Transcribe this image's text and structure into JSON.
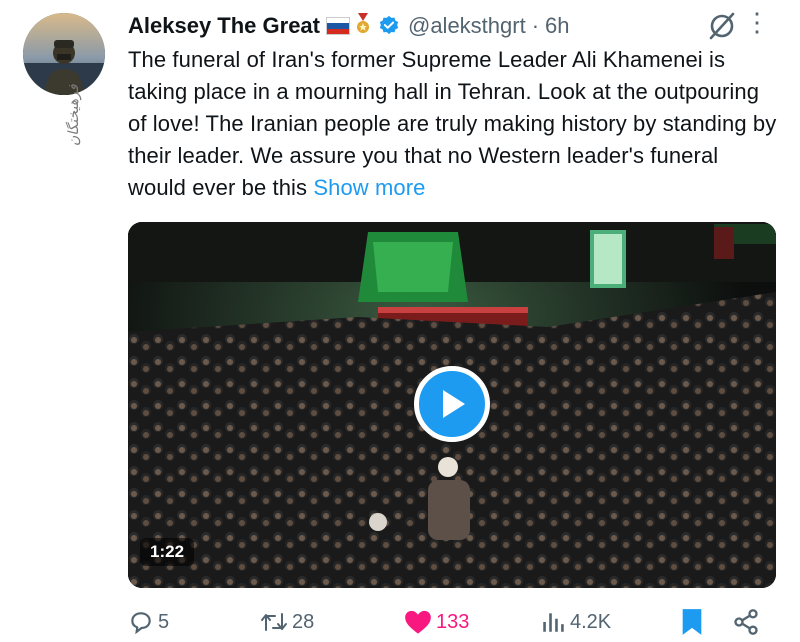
{
  "account": {
    "name": "Aleksey The Great",
    "handle": "@aleksthgrt",
    "time": "6h",
    "flag_icon": "russia-flag-icon",
    "medal_icon": "medal-icon",
    "verified_icon": "verified-badge-icon",
    "verified_color": "#1d9bf0"
  },
  "watermark": "فرهیختگان",
  "tweet": {
    "text": "The funeral of Iran's former Supreme Leader Ali Khamenei is taking place in a mourning hall in Tehran. Look at the outpouring of love! The Iranian people are truly making history by standing by their leader. We assure you that no Western leader's funeral would ever be this ",
    "show_more": "Show more"
  },
  "video": {
    "duration": "1:22",
    "play_icon": "play-icon"
  },
  "actions": {
    "replies": "5",
    "reposts": "28",
    "likes": "133",
    "views": "4.2K",
    "like_color": "#f91880",
    "bookmark_color": "#1d9bf0"
  },
  "colors": {
    "accent": "#1d9bf0",
    "muted": "#536471",
    "text": "#0f1419"
  }
}
